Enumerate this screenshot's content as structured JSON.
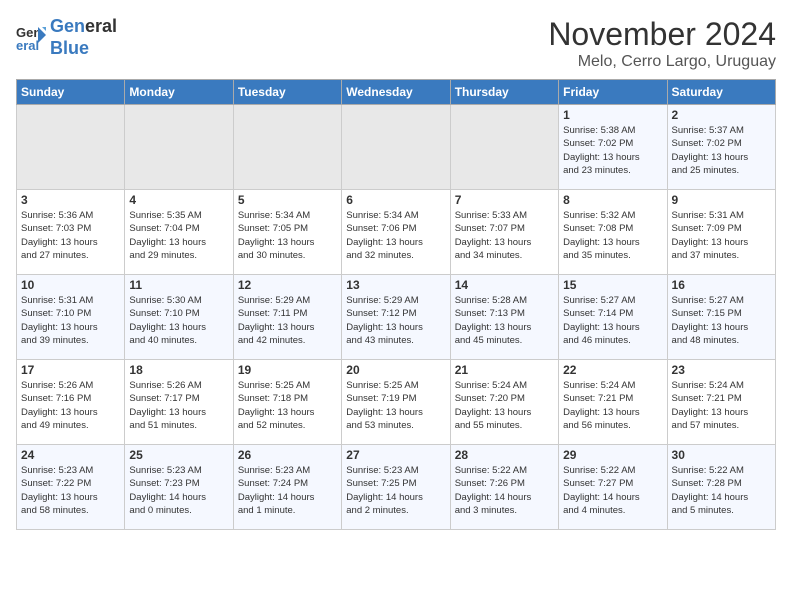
{
  "logo": {
    "line1": "General",
    "line2": "Blue"
  },
  "title": "November 2024",
  "subtitle": "Melo, Cerro Largo, Uruguay",
  "weekdays": [
    "Sunday",
    "Monday",
    "Tuesday",
    "Wednesday",
    "Thursday",
    "Friday",
    "Saturday"
  ],
  "weeks": [
    [
      {
        "day": "",
        "info": ""
      },
      {
        "day": "",
        "info": ""
      },
      {
        "day": "",
        "info": ""
      },
      {
        "day": "",
        "info": ""
      },
      {
        "day": "",
        "info": ""
      },
      {
        "day": "1",
        "info": "Sunrise: 5:38 AM\nSunset: 7:02 PM\nDaylight: 13 hours\nand 23 minutes."
      },
      {
        "day": "2",
        "info": "Sunrise: 5:37 AM\nSunset: 7:02 PM\nDaylight: 13 hours\nand 25 minutes."
      }
    ],
    [
      {
        "day": "3",
        "info": "Sunrise: 5:36 AM\nSunset: 7:03 PM\nDaylight: 13 hours\nand 27 minutes."
      },
      {
        "day": "4",
        "info": "Sunrise: 5:35 AM\nSunset: 7:04 PM\nDaylight: 13 hours\nand 29 minutes."
      },
      {
        "day": "5",
        "info": "Sunrise: 5:34 AM\nSunset: 7:05 PM\nDaylight: 13 hours\nand 30 minutes."
      },
      {
        "day": "6",
        "info": "Sunrise: 5:34 AM\nSunset: 7:06 PM\nDaylight: 13 hours\nand 32 minutes."
      },
      {
        "day": "7",
        "info": "Sunrise: 5:33 AM\nSunset: 7:07 PM\nDaylight: 13 hours\nand 34 minutes."
      },
      {
        "day": "8",
        "info": "Sunrise: 5:32 AM\nSunset: 7:08 PM\nDaylight: 13 hours\nand 35 minutes."
      },
      {
        "day": "9",
        "info": "Sunrise: 5:31 AM\nSunset: 7:09 PM\nDaylight: 13 hours\nand 37 minutes."
      }
    ],
    [
      {
        "day": "10",
        "info": "Sunrise: 5:31 AM\nSunset: 7:10 PM\nDaylight: 13 hours\nand 39 minutes."
      },
      {
        "day": "11",
        "info": "Sunrise: 5:30 AM\nSunset: 7:10 PM\nDaylight: 13 hours\nand 40 minutes."
      },
      {
        "day": "12",
        "info": "Sunrise: 5:29 AM\nSunset: 7:11 PM\nDaylight: 13 hours\nand 42 minutes."
      },
      {
        "day": "13",
        "info": "Sunrise: 5:29 AM\nSunset: 7:12 PM\nDaylight: 13 hours\nand 43 minutes."
      },
      {
        "day": "14",
        "info": "Sunrise: 5:28 AM\nSunset: 7:13 PM\nDaylight: 13 hours\nand 45 minutes."
      },
      {
        "day": "15",
        "info": "Sunrise: 5:27 AM\nSunset: 7:14 PM\nDaylight: 13 hours\nand 46 minutes."
      },
      {
        "day": "16",
        "info": "Sunrise: 5:27 AM\nSunset: 7:15 PM\nDaylight: 13 hours\nand 48 minutes."
      }
    ],
    [
      {
        "day": "17",
        "info": "Sunrise: 5:26 AM\nSunset: 7:16 PM\nDaylight: 13 hours\nand 49 minutes."
      },
      {
        "day": "18",
        "info": "Sunrise: 5:26 AM\nSunset: 7:17 PM\nDaylight: 13 hours\nand 51 minutes."
      },
      {
        "day": "19",
        "info": "Sunrise: 5:25 AM\nSunset: 7:18 PM\nDaylight: 13 hours\nand 52 minutes."
      },
      {
        "day": "20",
        "info": "Sunrise: 5:25 AM\nSunset: 7:19 PM\nDaylight: 13 hours\nand 53 minutes."
      },
      {
        "day": "21",
        "info": "Sunrise: 5:24 AM\nSunset: 7:20 PM\nDaylight: 13 hours\nand 55 minutes."
      },
      {
        "day": "22",
        "info": "Sunrise: 5:24 AM\nSunset: 7:21 PM\nDaylight: 13 hours\nand 56 minutes."
      },
      {
        "day": "23",
        "info": "Sunrise: 5:24 AM\nSunset: 7:21 PM\nDaylight: 13 hours\nand 57 minutes."
      }
    ],
    [
      {
        "day": "24",
        "info": "Sunrise: 5:23 AM\nSunset: 7:22 PM\nDaylight: 13 hours\nand 58 minutes."
      },
      {
        "day": "25",
        "info": "Sunrise: 5:23 AM\nSunset: 7:23 PM\nDaylight: 14 hours\nand 0 minutes."
      },
      {
        "day": "26",
        "info": "Sunrise: 5:23 AM\nSunset: 7:24 PM\nDaylight: 14 hours\nand 1 minute."
      },
      {
        "day": "27",
        "info": "Sunrise: 5:23 AM\nSunset: 7:25 PM\nDaylight: 14 hours\nand 2 minutes."
      },
      {
        "day": "28",
        "info": "Sunrise: 5:22 AM\nSunset: 7:26 PM\nDaylight: 14 hours\nand 3 minutes."
      },
      {
        "day": "29",
        "info": "Sunrise: 5:22 AM\nSunset: 7:27 PM\nDaylight: 14 hours\nand 4 minutes."
      },
      {
        "day": "30",
        "info": "Sunrise: 5:22 AM\nSunset: 7:28 PM\nDaylight: 14 hours\nand 5 minutes."
      }
    ]
  ]
}
